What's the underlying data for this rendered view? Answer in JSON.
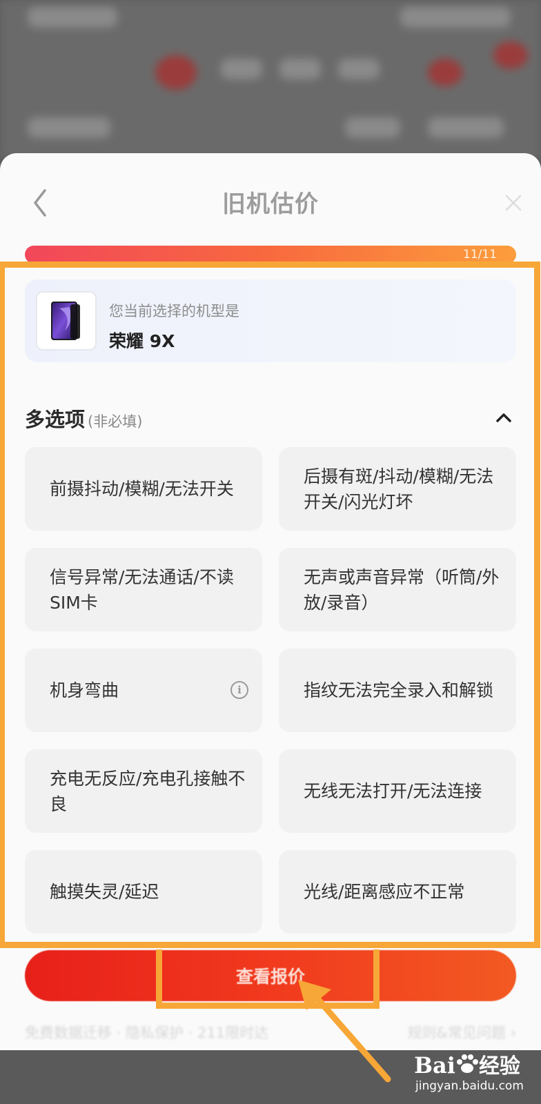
{
  "dialog": {
    "title": "旧机估价",
    "progress_text": "11/11",
    "progress": 1.0
  },
  "model": {
    "label": "您当前选择的机型是",
    "name": "荣耀 9X"
  },
  "section": {
    "title": "多选项",
    "subtitle": "(非必填)"
  },
  "options": [
    {
      "label": "前摄抖动/模糊/无法开关"
    },
    {
      "label": "后摄有斑/抖动/模糊/无法开关/闪光灯坏"
    },
    {
      "label": "信号异常/无法通话/不读SIM卡"
    },
    {
      "label": "无声或声音异常（听筒/外放/录音）"
    },
    {
      "label": "机身弯曲"
    },
    {
      "label": "指纹无法完全录入和解锁"
    },
    {
      "label": "充电无反应/充电孔接触不良"
    },
    {
      "label": "无线无法打开/无法连接"
    },
    {
      "label": "触摸失灵/延迟"
    },
    {
      "label": "光线/距离感应不正常"
    }
  ],
  "cta": {
    "label": "查看报价"
  },
  "footer": {
    "left": "免费数据迁移 · 隐私保护 · 211限时达",
    "right": "规则&常见问题 ›"
  },
  "watermark": {
    "brand": "Bai",
    "brand_suffix": "经验",
    "url": "jingyan.baidu.com"
  },
  "colors": {
    "accent": "#f7a737",
    "cta": "#e8201a",
    "progress_start": "#f2475a",
    "progress_end": "#fc9d3c"
  },
  "icons": {
    "back": "chevron-left-icon",
    "close": "close-icon",
    "collapse": "chevron-up-icon",
    "info": "info-icon"
  }
}
